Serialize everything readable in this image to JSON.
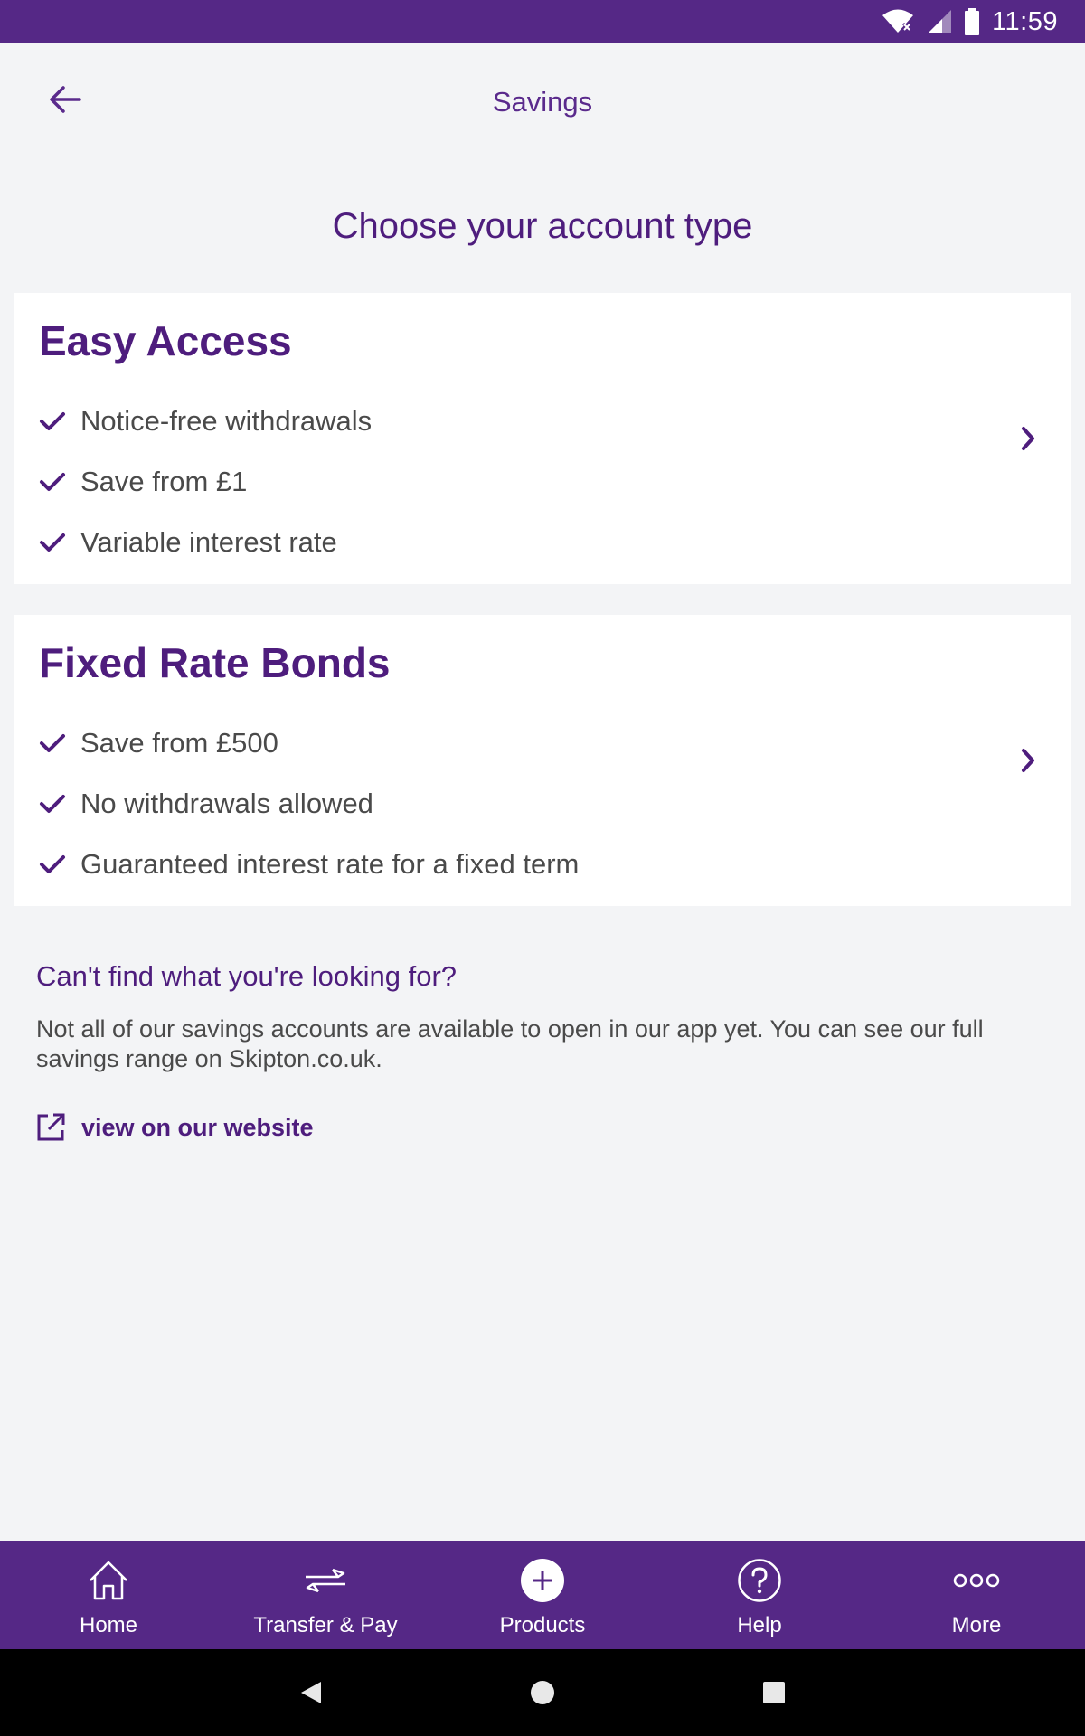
{
  "status_bar": {
    "time": "11:59"
  },
  "header": {
    "title": "Savings"
  },
  "page_heading": "Choose your account type",
  "accounts": [
    {
      "title": "Easy Access",
      "features": [
        "Notice-free withdrawals",
        "Save from £1",
        "Variable interest rate"
      ]
    },
    {
      "title": "Fixed Rate Bonds",
      "features": [
        "Save from £500",
        "No withdrawals allowed",
        "Guaranteed interest rate for a fixed term"
      ]
    }
  ],
  "info": {
    "heading": "Can't find what you're looking for?",
    "text": "Not all of our savings accounts are available to open in our app yet. You can see our full savings range on Skipton.co.uk.",
    "link_label": "view on our website"
  },
  "bottom_nav": [
    {
      "label": "Home",
      "icon": "home-icon"
    },
    {
      "label": "Transfer & Pay",
      "icon": "transfer-icon"
    },
    {
      "label": "Products",
      "icon": "plus-circle-icon"
    },
    {
      "label": "Help",
      "icon": "help-icon"
    },
    {
      "label": "More",
      "icon": "more-icon"
    }
  ],
  "colors": {
    "brand_purple": "#552886",
    "heading_purple": "#4e1d7d",
    "background": "#f3f4f6",
    "card": "#ffffff"
  }
}
